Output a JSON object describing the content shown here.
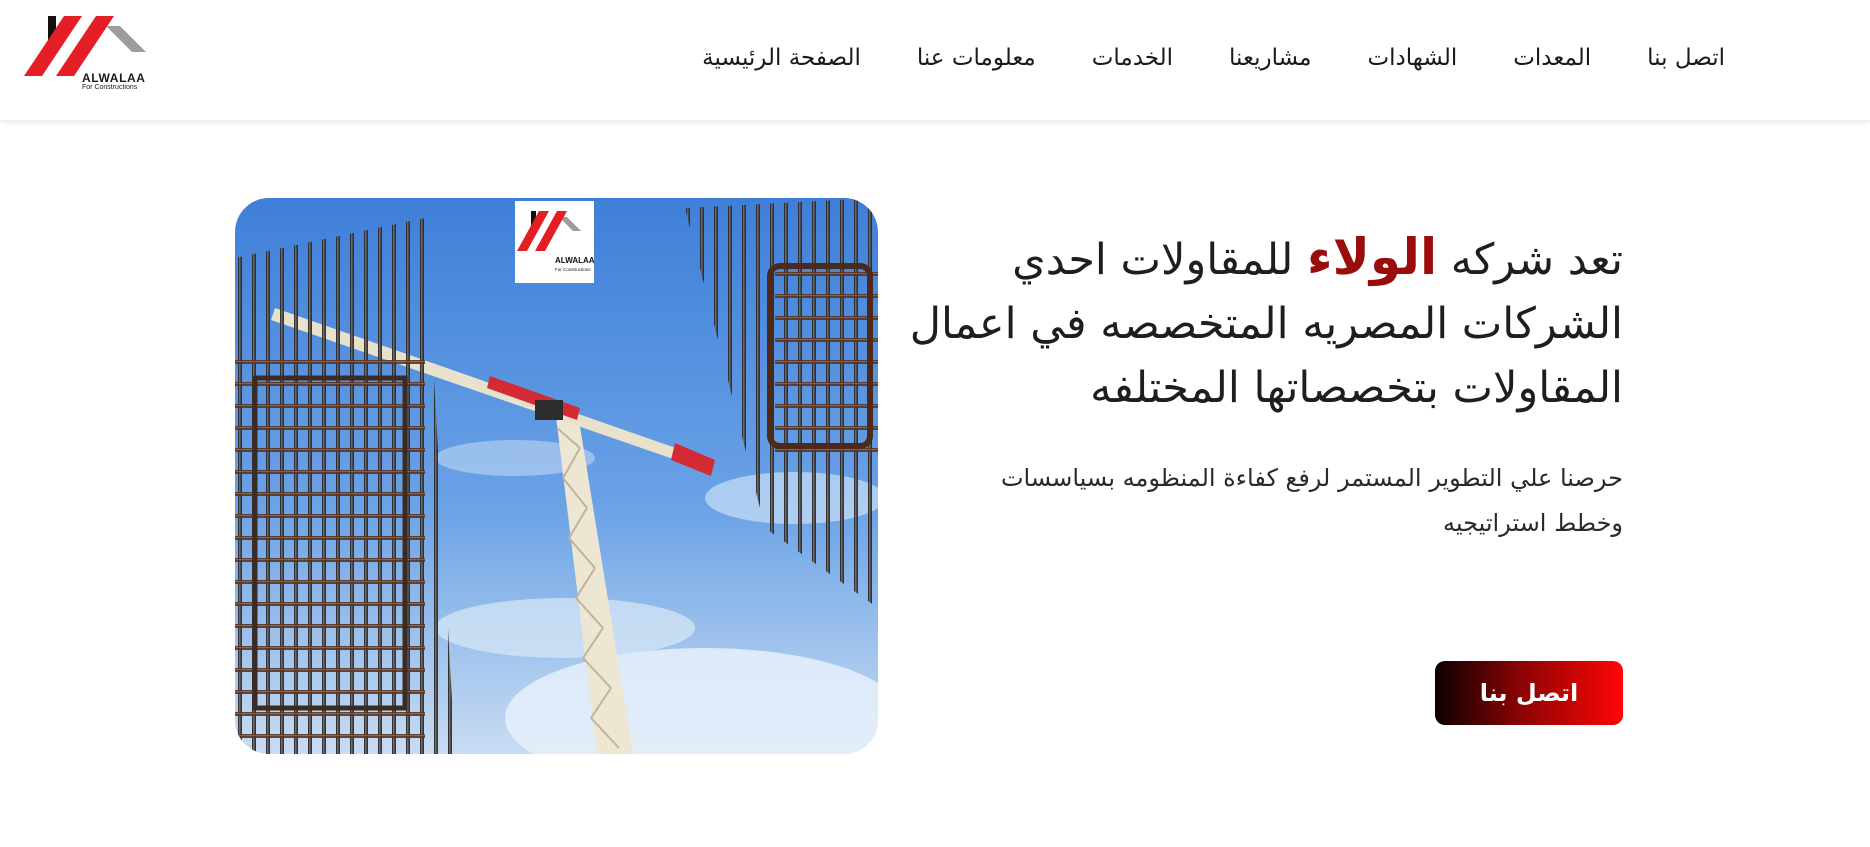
{
  "header": {
    "logo": {
      "name": "ALWALAA",
      "tagline": "For Constructions",
      "icon": "house-roof-logo"
    },
    "nav": [
      {
        "label": "الصفحة الرئيسية"
      },
      {
        "label": "معلومات عنا"
      },
      {
        "label": "الخدمات"
      },
      {
        "label": "مشاريعنا"
      },
      {
        "label": "الشهادات"
      },
      {
        "label": "المعدات"
      },
      {
        "label": "اتصل بنا"
      }
    ]
  },
  "hero": {
    "headline_prefix": "تعد شركه",
    "brand_word": "الولاء",
    "headline_rest": "للمقاولات احدي الشركات المصريه المتخصصه في اعمال المقاولات بتخصصاتها المختلفه",
    "lead": "حرصنا علي التطوير المستمر لرفع كفاءة المنظومه بسياسسات وخطط استراتيجيه",
    "cta_label": "اتصل بنا",
    "image": {
      "subject": "construction-crane-and-rebar-photo",
      "badge_name": "ALWALAA",
      "badge_tagline": "For Constructions"
    }
  },
  "colors": {
    "brand_red": "#9b0d0d",
    "logo_red": "#e31e25",
    "logo_grey": "#9d9d9d",
    "button_gradient_start": "#0d0000",
    "button_gradient_end": "#ff0606"
  }
}
